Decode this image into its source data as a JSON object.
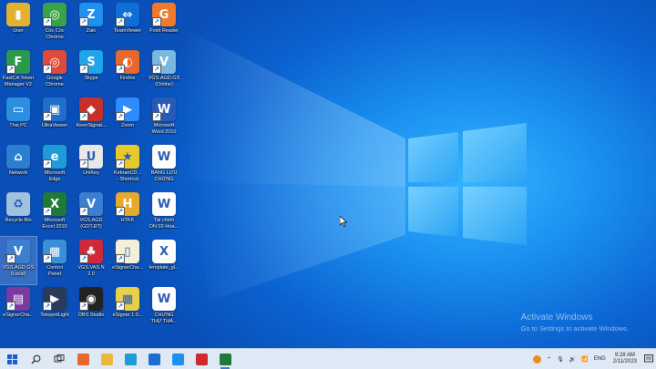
{
  "desktop": {
    "columns": [
      [
        {
          "name": "user-folder",
          "label": "User",
          "icon": "folder-user-icon",
          "color": "#e8b93a",
          "glyph": "👤",
          "shortcut": false
        },
        {
          "name": "network",
          "label": "This PC",
          "icon": "computer-icon",
          "color": "#2a8ad8",
          "glyph": "🖥",
          "shortcut": false
        }
      ]
    ],
    "icons": [
      {
        "id": "user",
        "label": "User",
        "icon": "folder-user-icon",
        "color": "#e2b12f",
        "glyph": "▮",
        "shortcut": false,
        "col": 0,
        "row": 0
      },
      {
        "id": "fastca",
        "label": "FastCA Token\nManager V2",
        "icon": "fastca-icon",
        "color": "#2a9a4a",
        "glyph": "F",
        "shortcut": true,
        "col": 0,
        "row": 1
      },
      {
        "id": "thispc",
        "label": "This PC",
        "icon": "computer-icon",
        "color": "#2b8ee0",
        "glyph": "▭",
        "shortcut": false,
        "col": 0,
        "row": 2
      },
      {
        "id": "network",
        "label": "Network",
        "icon": "network-icon",
        "color": "#2a7fd0",
        "glyph": "⌂",
        "shortcut": false,
        "col": 0,
        "row": 3
      },
      {
        "id": "recycle",
        "label": "Recycle Bin",
        "icon": "recycle-bin-icon",
        "color": "#9fc3de",
        "glyph": "♻",
        "shortcut": false,
        "col": 0,
        "row": 4
      },
      {
        "id": "vgs-local",
        "label": "VGS.AGD.GS\n(Local)",
        "icon": "vgs-agd-icon",
        "color": "#3b7fd0",
        "glyph": "V",
        "shortcut": true,
        "col": 0,
        "row": 5
      },
      {
        "id": "esigner-1",
        "label": "eSignerCha...",
        "icon": "winrar-icon",
        "color": "#7a3aa0",
        "glyph": "▤",
        "shortcut": true,
        "col": 0,
        "row": 6
      },
      {
        "id": "coccoc",
        "label": "Cốc Cốc\nChrome",
        "icon": "chrome-icon",
        "color": "#3aa34a",
        "glyph": "◎",
        "shortcut": true,
        "col": 1,
        "row": 0
      },
      {
        "id": "chrome",
        "label": "Google\nChrome",
        "icon": "chrome-icon",
        "color": "#e04a3a",
        "glyph": "◎",
        "shortcut": true,
        "col": 1,
        "row": 1
      },
      {
        "id": "ultraviewer",
        "label": "UltraViewer",
        "icon": "ultraviewer-icon",
        "color": "#1f6fc8",
        "glyph": "▣",
        "shortcut": true,
        "col": 1,
        "row": 2
      },
      {
        "id": "edge",
        "label": "Microsoft\nEdge",
        "icon": "edge-icon",
        "color": "#1f9bd8",
        "glyph": "e",
        "shortcut": true,
        "col": 1,
        "row": 3
      },
      {
        "id": "excel",
        "label": "Microsoft\nExcel 2010",
        "icon": "excel-icon",
        "color": "#1f7a3a",
        "glyph": "X",
        "shortcut": true,
        "col": 1,
        "row": 4
      },
      {
        "id": "control",
        "label": "Control\nPanel",
        "icon": "control-panel-icon",
        "color": "#3a8fd8",
        "glyph": "▦",
        "shortcut": true,
        "col": 1,
        "row": 5
      },
      {
        "id": "teleport",
        "label": "TeleportLight",
        "icon": "teleport-icon",
        "color": "#2a3a5a",
        "glyph": "▶",
        "shortcut": true,
        "col": 1,
        "row": 6
      },
      {
        "id": "zalo",
        "label": "Zalo",
        "icon": "zalo-icon",
        "color": "#1f8ff0",
        "glyph": "Z",
        "shortcut": true,
        "col": 2,
        "row": 0
      },
      {
        "id": "skype",
        "label": "Skype",
        "icon": "skype-icon",
        "color": "#1fa6e8",
        "glyph": "S",
        "shortcut": true,
        "col": 2,
        "row": 1
      },
      {
        "id": "ksign",
        "label": "KeenSignat...",
        "icon": "signature-icon",
        "color": "#c8302a",
        "glyph": "◆",
        "shortcut": true,
        "col": 2,
        "row": 2
      },
      {
        "id": "unikey",
        "label": "UniKey",
        "icon": "unikey-icon",
        "color": "#e8e8e8",
        "glyph": "U",
        "shortcut": true,
        "col": 2,
        "row": 3
      },
      {
        "id": "vgs-gdtdt",
        "label": "VGS.AGD\n(GDT.ĐT)",
        "icon": "vgs-icon",
        "color": "#3a7fd0",
        "glyph": "V",
        "shortcut": true,
        "col": 2,
        "row": 4
      },
      {
        "id": "vgs-vas",
        "label": "VGS.VAS.N\n2.0",
        "icon": "vgs-vas-icon",
        "color": "#d02a3a",
        "glyph": "♣",
        "shortcut": true,
        "col": 2,
        "row": 5
      },
      {
        "id": "obs",
        "label": "OBS Studio",
        "icon": "obs-icon",
        "color": "#222222",
        "glyph": "◉",
        "shortcut": true,
        "col": 2,
        "row": 6
      },
      {
        "id": "teamviewer",
        "label": "TeamViewer",
        "icon": "teamviewer-icon",
        "color": "#0e6fd8",
        "glyph": "⇔",
        "shortcut": true,
        "col": 3,
        "row": 0
      },
      {
        "id": "firefox",
        "label": "Firefox",
        "icon": "firefox-icon",
        "color": "#e8672a",
        "glyph": "◐",
        "shortcut": true,
        "col": 3,
        "row": 1
      },
      {
        "id": "zoom",
        "label": "Zoom",
        "icon": "zoom-icon",
        "color": "#2d8cff",
        "glyph": "▶",
        "shortcut": true,
        "col": 3,
        "row": 2
      },
      {
        "id": "ketoan",
        "label": "KetoanCD...\n- Shortcut",
        "icon": "ketoan-icon",
        "color": "#e8c82a",
        "glyph": "★",
        "shortcut": true,
        "col": 3,
        "row": 3
      },
      {
        "id": "htkk",
        "label": "HTKK",
        "icon": "htkk-icon",
        "color": "#e8a82a",
        "glyph": "H",
        "shortcut": true,
        "col": 3,
        "row": 4
      },
      {
        "id": "esigner-2",
        "label": "eSignerCha...",
        "icon": "file-icon",
        "color": "#f4f0d8",
        "glyph": "▯",
        "shortcut": true,
        "col": 3,
        "row": 5
      },
      {
        "id": "esigner-3",
        "label": "eSigner 1.0...",
        "icon": "esigner-icon",
        "color": "#e8d04a",
        "glyph": "▦",
        "shortcut": true,
        "col": 3,
        "row": 6
      },
      {
        "id": "foxit",
        "label": "Foxit Reader",
        "icon": "foxit-icon",
        "color": "#f07a2a",
        "glyph": "G",
        "shortcut": true,
        "col": 4,
        "row": 0
      },
      {
        "id": "vgs-online",
        "label": "VGS.AGD.GS\n(Online)",
        "icon": "vgs-online-icon",
        "color": "#7ab8e0",
        "glyph": "V",
        "shortcut": true,
        "col": 4,
        "row": 1
      },
      {
        "id": "word",
        "label": "Microsoft\nWord 2010",
        "icon": "word-icon",
        "color": "#2a5ab8",
        "glyph": "W",
        "shortcut": true,
        "col": 4,
        "row": 2
      },
      {
        "id": "bangluu",
        "label": "BẢNG LƯU\nCHỨNG",
        "icon": "word-doc-icon",
        "color": "#ffffff",
        "glyph": "W",
        "shortcut": false,
        "col": 4,
        "row": 3
      },
      {
        "id": "taichinh",
        "label": "Tài chính\nDN 02-Hoa...",
        "icon": "word-doc-icon",
        "color": "#ffffff",
        "glyph": "W",
        "shortcut": false,
        "col": 4,
        "row": 4
      },
      {
        "id": "template",
        "label": "template_gl...",
        "icon": "excel-doc-icon",
        "color": "#ffffff",
        "glyph": "X",
        "shortcut": false,
        "col": 4,
        "row": 5
      },
      {
        "id": "chungtu",
        "label": "CHỨNG\nTHỰ THẢ...",
        "icon": "word-doc-icon",
        "color": "#ffffff",
        "glyph": "W",
        "shortcut": false,
        "col": 4,
        "row": 6
      }
    ],
    "selected_icon": "vgs-local"
  },
  "watermark": {
    "title": "Activate Windows",
    "subtitle": "Go to Settings to activate Windows."
  },
  "taskbar": {
    "apps": [
      {
        "name": "start-button",
        "icon": "windows-start-icon"
      },
      {
        "name": "search-button",
        "icon": "search-icon"
      },
      {
        "name": "task-view-button",
        "icon": "task-view-icon"
      },
      {
        "name": "taskbar-firefox",
        "icon": "firefox-icon",
        "color": "#e8672a",
        "active": false
      },
      {
        "name": "taskbar-explorer",
        "icon": "folder-icon",
        "color": "#e8b93a",
        "active": false
      },
      {
        "name": "taskbar-edge",
        "icon": "edge-icon",
        "color": "#1f9bd8",
        "active": false
      },
      {
        "name": "taskbar-mail",
        "icon": "mail-icon",
        "color": "#1a6ed0",
        "active": false
      },
      {
        "name": "taskbar-app-2",
        "icon": "zalo-icon",
        "color": "#1f8ff0",
        "active": false
      },
      {
        "name": "taskbar-app-3",
        "icon": "record-icon",
        "color": "#d02a2a",
        "active": false
      },
      {
        "name": "taskbar-excel",
        "icon": "excel-icon",
        "color": "#1f7a3a",
        "active": true
      }
    ],
    "tray": {
      "lang": "ENG",
      "time": "9:28 AM",
      "date": "2/11/2023"
    }
  }
}
